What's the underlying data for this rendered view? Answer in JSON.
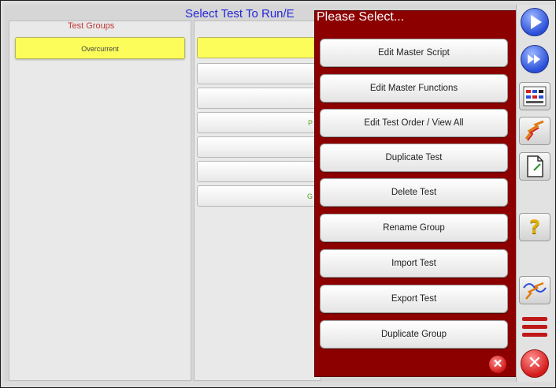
{
  "page": {
    "title": "Select Test To Run/E"
  },
  "groups": {
    "header": "Test Groups",
    "items": [
      {
        "label": "Overcurrent"
      }
    ]
  },
  "tests": {
    "items": [
      {
        "label": ""
      },
      {
        "label": ""
      },
      {
        "label": ""
      },
      {
        "label": "P"
      },
      {
        "label": ""
      },
      {
        "label": ""
      },
      {
        "label": "G"
      }
    ]
  },
  "dialog": {
    "title": "Please Select...",
    "buttons": [
      {
        "label": "Edit Master Script"
      },
      {
        "label": "Edit Master Functions"
      },
      {
        "label": "Edit Test Order / View All"
      },
      {
        "label": "Duplicate Test"
      },
      {
        "label": "Delete Test"
      },
      {
        "label": "Rename Group"
      },
      {
        "label": "Import Test"
      },
      {
        "label": "Export Test"
      },
      {
        "label": "Duplicate Group"
      }
    ],
    "close_icon": "close-icon"
  },
  "toolbar": {
    "icons": [
      "play-icon",
      "fast-forward-icon",
      "test-settings-icon",
      "lightning-icon",
      "document-icon",
      "help-icon",
      "waveform-icon",
      "list-icon",
      "exit-icon"
    ],
    "help_glyph": "?"
  },
  "colors": {
    "dialog_bg": "#8c0000",
    "selected_row": "#fcfc5a",
    "title_blue": "#2626d8",
    "header_red": "#c03838"
  }
}
